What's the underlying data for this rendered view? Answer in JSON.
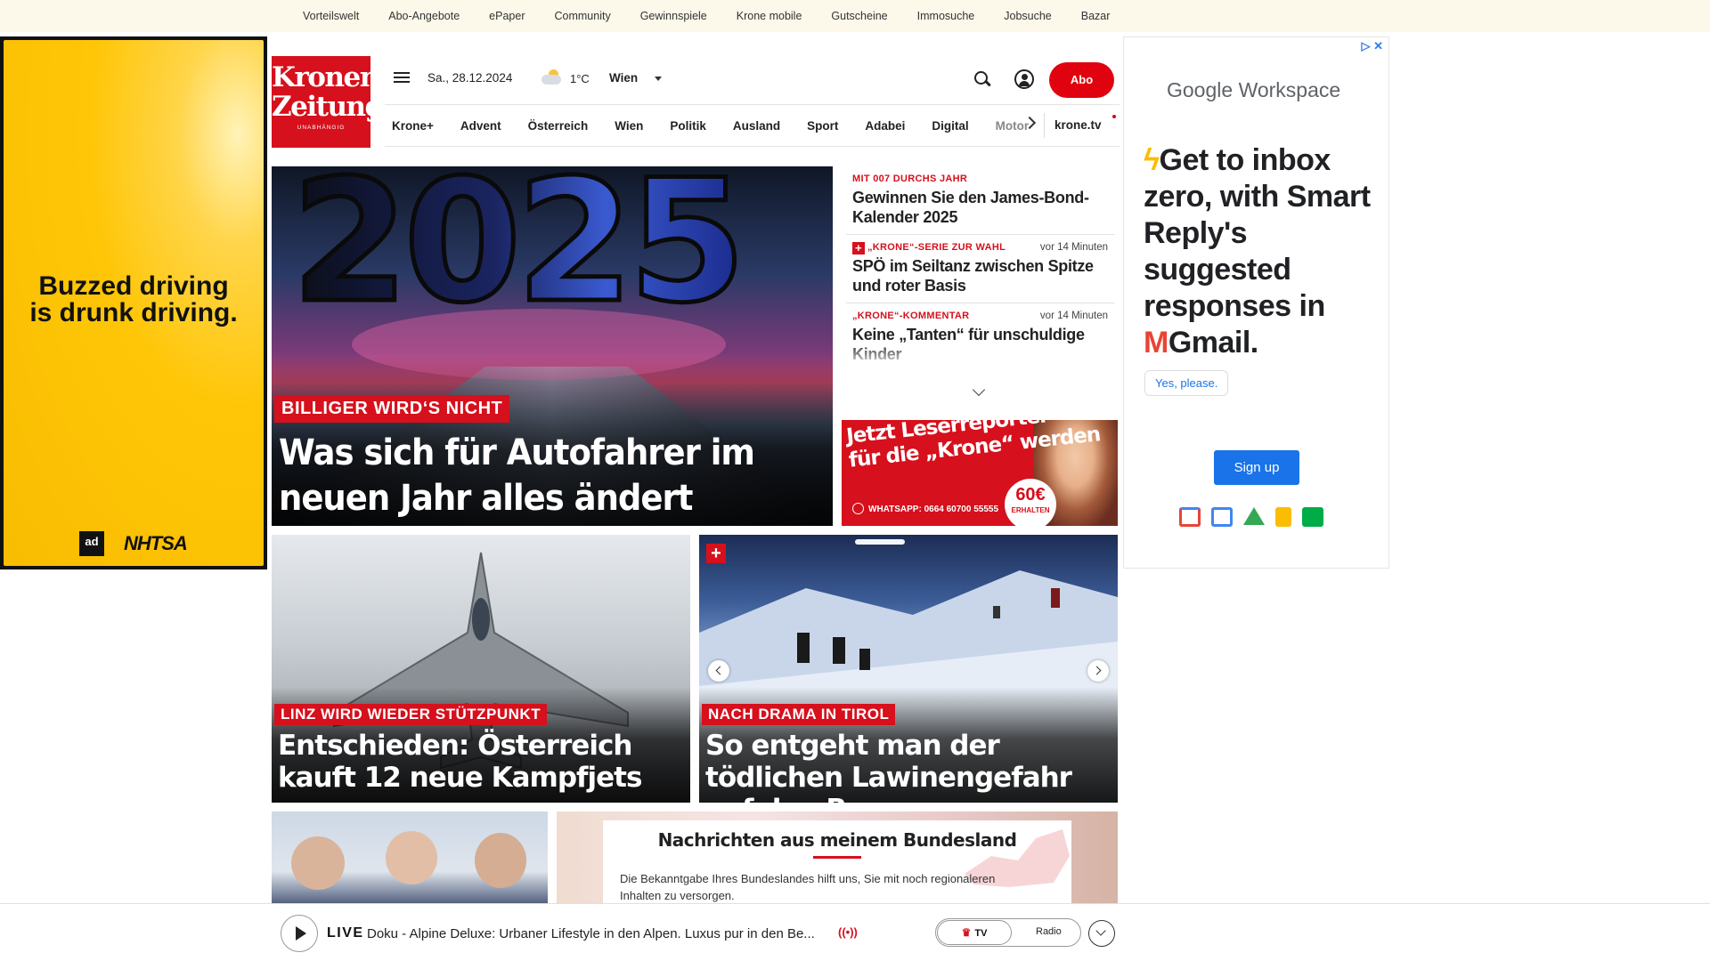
{
  "topbar": {
    "links": [
      "Vorteilswelt",
      "Abo-Angebote",
      "ePaper",
      "Community",
      "Gewinnspiele",
      "Krone mobile",
      "Gutscheine",
      "Immosuche",
      "Jobsuche",
      "Bazar"
    ]
  },
  "ad_left": {
    "line1": "Buzzed driving",
    "line2": "is drunk driving.",
    "logo1": "ad",
    "logo2": "NHTSA"
  },
  "ad_right": {
    "adchoice": "▷ ✕",
    "brand_google": "Google",
    "brand_product": "Workspace",
    "headline_a": "Get to inbox zero, with Smart Reply's suggested responses",
    "headline_b": "in",
    "headline_c": "Gmail.",
    "yes_label": "Yes, please.",
    "signup_label": "Sign up",
    "app_colors": [
      "#ea4335",
      "#4285f4",
      "#34a853",
      "#fbbc04",
      "#00ac47"
    ]
  },
  "header": {
    "logo_line1": "Kronen",
    "logo_line2": "Zeitung",
    "logo_tagline": "UNABHÄNGIG",
    "date": "Sa., 28.12.2024",
    "temperature": "1°C",
    "city": "Wien",
    "abo_label": "Abo"
  },
  "nav": {
    "items": [
      "Krone+",
      "Advent",
      "Österreich",
      "Wien",
      "Politik",
      "Ausland",
      "Sport",
      "Adabei",
      "Digital"
    ],
    "faded_item": "Motor",
    "krone_tv": "krone.tv"
  },
  "hero": {
    "image_text": "2025",
    "kicker": "Billiger wird‘s nicht",
    "title": "Was sich für Autofahrer im neuen Jahr alles ändert"
  },
  "newslist": {
    "items": [
      {
        "kicker": "Mit 007 durchs Jahr",
        "time": "",
        "title": "Gewinnen Sie den James-Bond-Kalender 2025"
      },
      {
        "kicker": "„Krone“-Serie zur Wahl",
        "time": "vor 14 Minuten",
        "title": "SPÖ im Seiltanz zwischen Spitze und roter Basis"
      },
      {
        "kicker": "„Krone“-Kommentar",
        "time": "vor 14 Minuten",
        "title": "Keine „Tanten“ für unschuldige Kinder"
      }
    ],
    "plus_symbol": "+"
  },
  "promo": {
    "line1": "Jetzt Leserreporter",
    "line2": "für die „Krone“ werden",
    "whatsapp": "WHATSAPP: 0664 60700 55555",
    "badge_amount": "60€",
    "badge_text": "ERHALTEN"
  },
  "cards": [
    {
      "kicker": "Linz wird wieder Stützpunkt",
      "title": "Entschieden: Österreich kauft 12 neue Kampfjets"
    },
    {
      "kicker": "Nach Drama in Tirol",
      "title": "So entgeht man der tödlichen Lawinengefahr auf den Bergen"
    }
  ],
  "bundesland": {
    "title": "Nachrichten aus meinem Bundesland",
    "body": "Die Bekanntgabe Ihres Bundeslandes hilft uns, Sie mit noch regionaleren Inhalten zu versorgen."
  },
  "livebar": {
    "live_label": "LIVE",
    "program": "Doku - Alpine Deluxe: Urbaner Lifestyle in den Alpen. Luxus pur in den Be...",
    "signal": "((•))",
    "tv_label": "TV",
    "radio_label": "Radio"
  }
}
